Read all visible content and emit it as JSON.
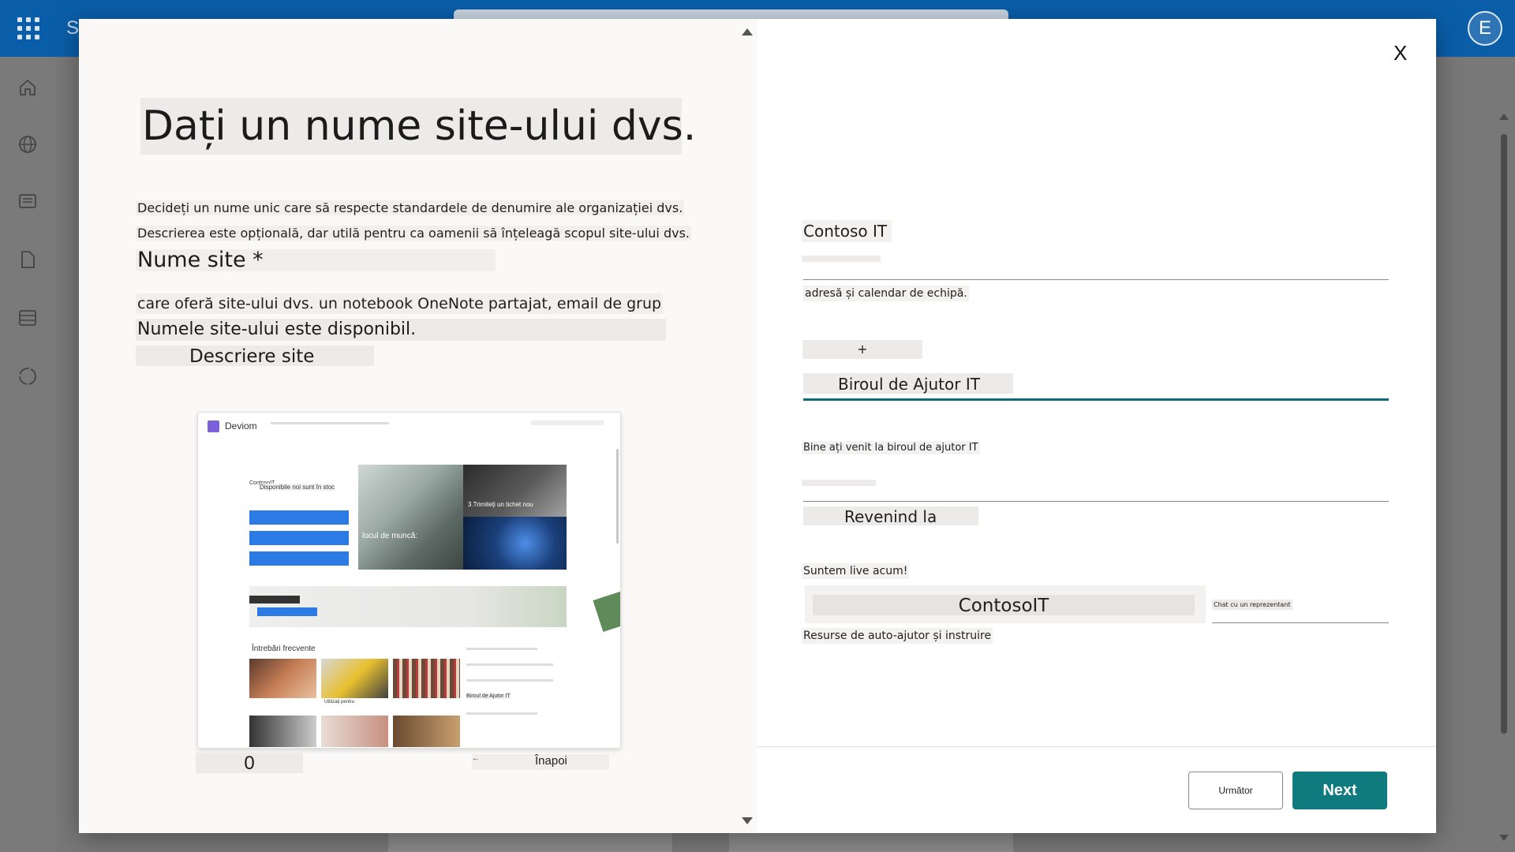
{
  "app": {
    "letter": "S",
    "avatar_initial": "E"
  },
  "rail": {
    "icons": [
      "home-icon",
      "globe-icon",
      "news-icon",
      "document-icon",
      "list-icon",
      "circle-icon"
    ]
  },
  "left": {
    "title": "Dați un nume site-ului dvs.",
    "desc1": "Decideți un nume unic care să respecte standardele de denumire ale organizației dvs.",
    "desc2": "Descrierea este opțională, dar utilă pentru ca oamenii să înțeleagă scopul site-ului dvs.",
    "field_label": "Nume site *",
    "line_a": "care oferă site-ului dvs. un notebook OneNote partajat, email de grup",
    "line_b": "Numele site-ului este disponibil.",
    "line_c": "Descriere site",
    "page_number": "0",
    "back_label": "Înapoi"
  },
  "preview": {
    "site_name": "Deviom",
    "label_it": "ContosoIT",
    "tagline": "Disponibile noi sunt în stoc",
    "img1_text": "locul de muncă:",
    "img2_text": "3.Trimiteți un tichet nou",
    "faq_title": "Întrebări frecvente",
    "card_text": "Utilizați pentru",
    "list_header": "Biroul de Ajutor IT"
  },
  "right": {
    "site_name_value": "Contoso IT",
    "description": "adresă și calendar de echipă.",
    "plus": "+",
    "helpdesk": "Biroul de Ajutor IT",
    "welcome": "Bine ați venit la biroul de ajutor IT",
    "back": "Revenind la",
    "live": "Suntem live acum!",
    "contoso": "ContosoIT",
    "chat": "Chat cu un reprezentant",
    "resources": "Resurse de auto-ajutor și instruire",
    "close": "X"
  },
  "footer": {
    "secondary": "Următor",
    "primary": "Next"
  },
  "colors": {
    "topbar": "#0a5ea8",
    "primary": "#0f7b7f",
    "accent_line": "#0f6c75"
  }
}
